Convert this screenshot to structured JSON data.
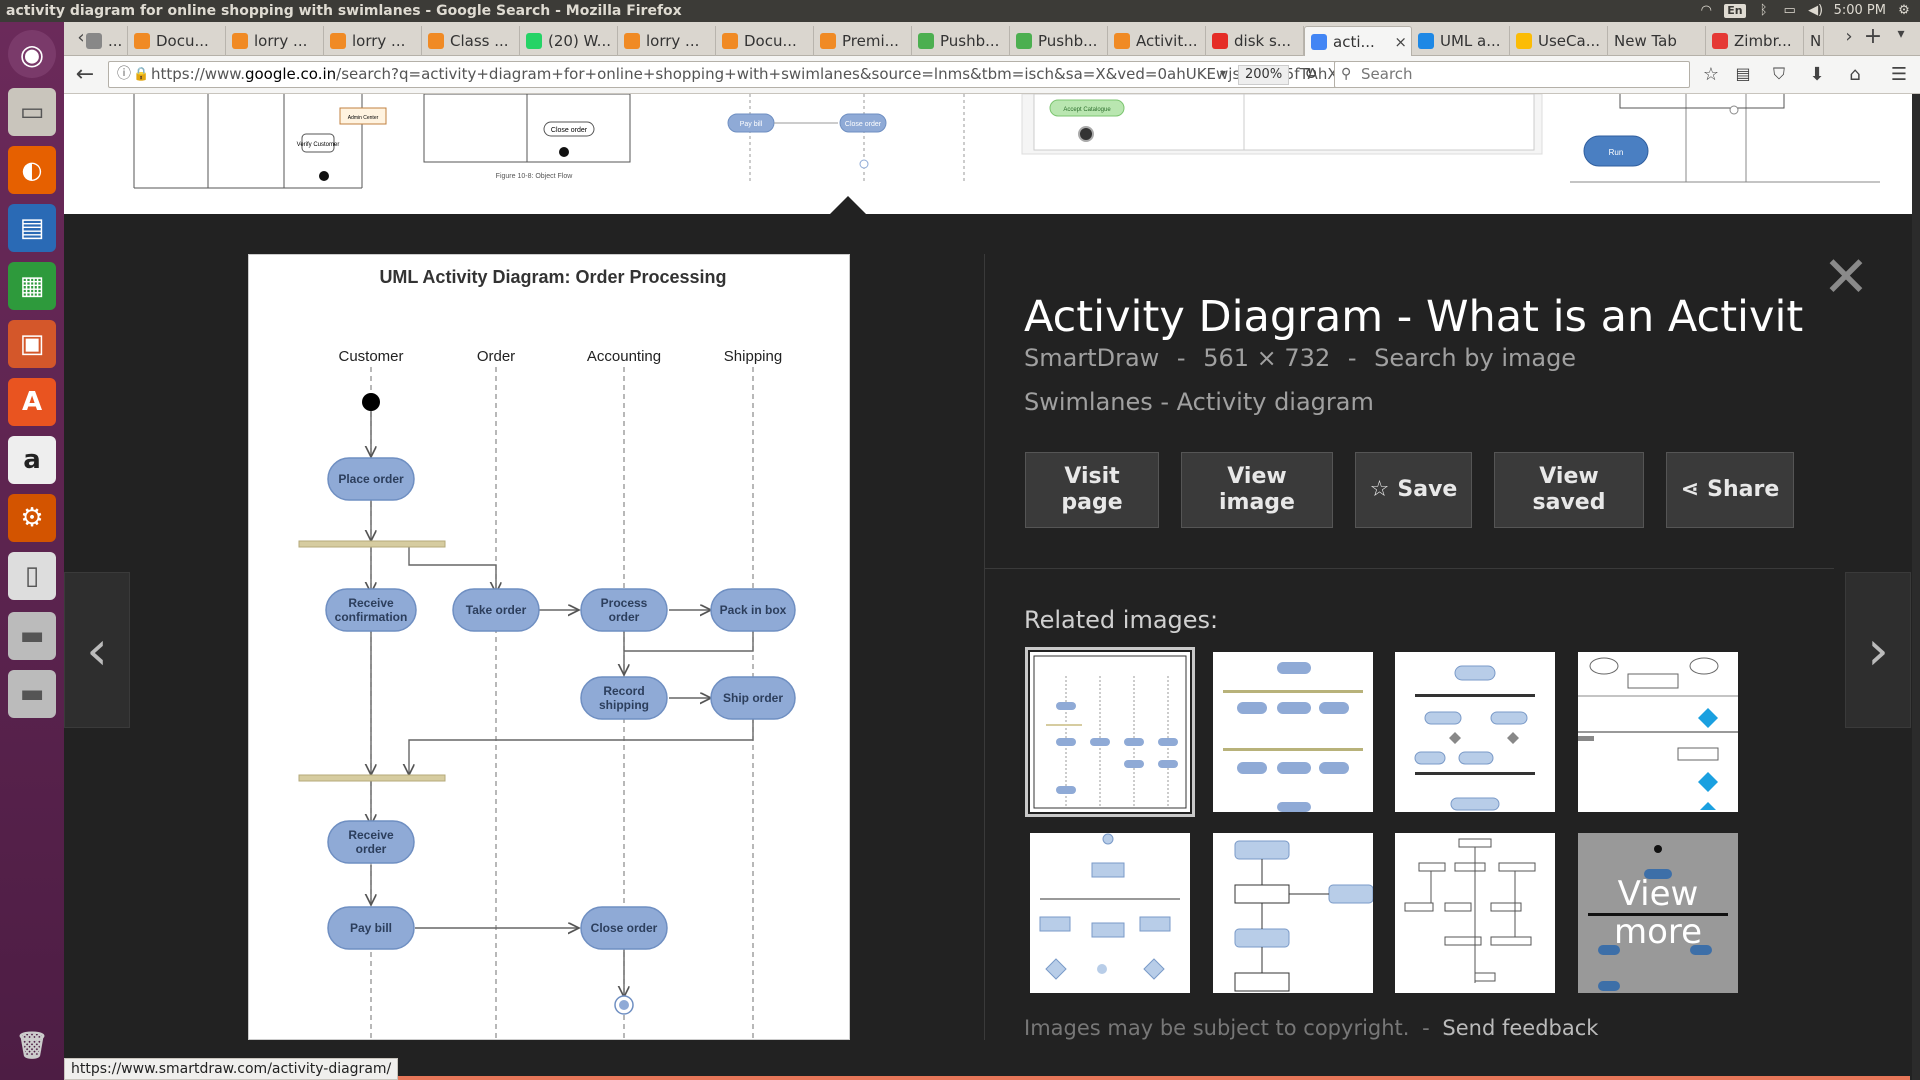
{
  "window_title": "activity diagram for online shopping with swimlanes - Google Search - Mozilla Firefox",
  "system": {
    "keyboard": "En",
    "clock": "5:00 PM"
  },
  "tabs": [
    {
      "label": "...",
      "color": "#888"
    },
    {
      "label": "Docu...",
      "color": "#f08a24"
    },
    {
      "label": "lorry ...",
      "color": "#f08a24"
    },
    {
      "label": "lorry ...",
      "color": "#f08a24"
    },
    {
      "label": "Class ...",
      "color": "#f08a24"
    },
    {
      "label": "(20) W...",
      "color": "#25d366"
    },
    {
      "label": "lorry ...",
      "color": "#f08a24"
    },
    {
      "label": "Docu...",
      "color": "#f08a24"
    },
    {
      "label": "Premi...",
      "color": "#f08a24"
    },
    {
      "label": "Pushb...",
      "color": "#4caf50"
    },
    {
      "label": "Pushb...",
      "color": "#4caf50"
    },
    {
      "label": "Activit...",
      "color": "#f08a24"
    },
    {
      "label": "disk s...",
      "color": "#e52d27"
    },
    {
      "label": "acti...",
      "color": "#4285f4"
    },
    {
      "label": "UML a...",
      "color": "#1e88e5"
    },
    {
      "label": "UseCa...",
      "color": "#fbbc05"
    },
    {
      "label": "New Tab",
      "color": ""
    },
    {
      "label": "Zimbr...",
      "color": "#e53935"
    },
    {
      "label": "N",
      "color": ""
    }
  ],
  "nav": {
    "url_prefix": "https://www.",
    "url_domain": "google.co.in",
    "url_rest": "/search?q=activity+diagram+for+online+shopping+with+swimlanes&source=lnms&tbm=isch&sa=X&ved=0ahUKEwjsieHXn5fTAhX",
    "zoom": "200%",
    "search_placeholder": "Search"
  },
  "preview": {
    "title": "Activity Diagram - What is an Activity ...",
    "source": "SmartDraw",
    "dimensions": "561 × 732",
    "search_by_image": "Search by image",
    "dash": "-",
    "subtitle": "Swimlanes - Activity diagram",
    "buttons": {
      "visit": "Visit page",
      "view_image": "View image",
      "save": "Save",
      "view_saved": "View saved",
      "share": "Share"
    },
    "related_label": "Related images:",
    "view_more": "View more",
    "copyright": "Images may be subject to copyright.",
    "feedback": "Send feedback"
  },
  "diagram": {
    "title": "UML Activity Diagram: Order Processing",
    "lanes": [
      "Customer",
      "Order",
      "Accounting",
      "Shipping"
    ],
    "nodes": {
      "place_order": "Place order",
      "receive_conf_1": "Receive",
      "receive_conf_2": "confirmation",
      "take_order": "Take order",
      "process_order_1": "Process",
      "process_order_2": "order",
      "pack_in_box": "Pack in box",
      "record_shipping_1": "Record",
      "record_shipping_2": "shipping",
      "ship_order": "Ship order",
      "receive_order_1": "Receive",
      "receive_order_2": "order",
      "pay_bill": "Pay bill",
      "close_order": "Close order"
    },
    "colors": {
      "node_fill": "#8faad6",
      "node_stroke": "#6f8fc2",
      "bar": "#d6cca0"
    }
  },
  "thumbstrip": {
    "t1_a": "Verify Customer",
    "t1_b": "Admin Center",
    "t2_a": "Close order",
    "t2_caption": "Figure 10-8: Object Flow",
    "t3_a": "Pay bill",
    "t3_b": "Close order",
    "t4_a": "Accept Catalogue",
    "t5_a": "Run"
  },
  "status_url": "https://www.smartdraw.com/activity-diagram/"
}
